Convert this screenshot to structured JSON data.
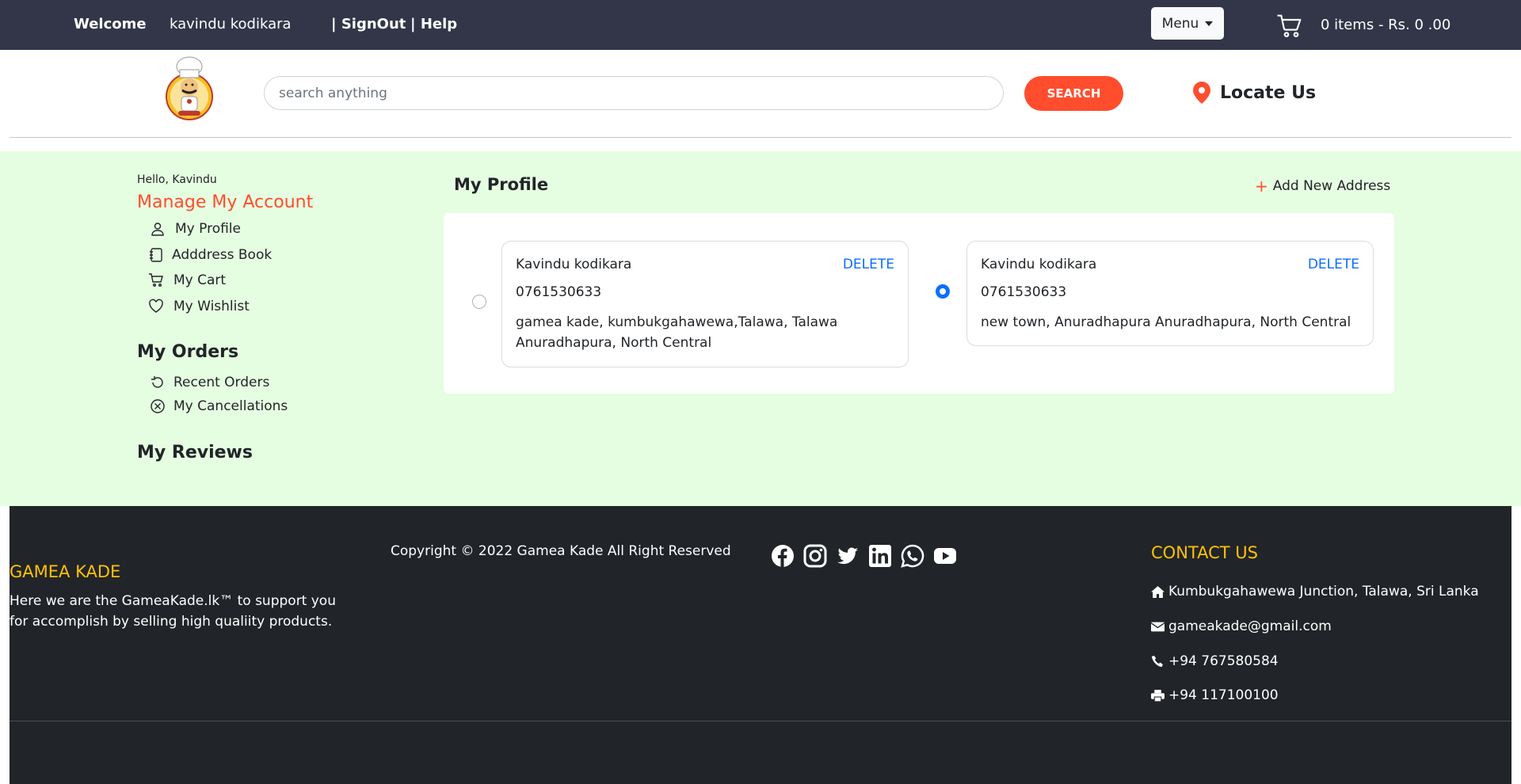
{
  "topbar": {
    "welcome": "Welcome",
    "username": "kavindu kodikara",
    "signout": "| SignOut",
    "help": "| Help",
    "menu_label": "Menu",
    "cart_summary": "0 items - Rs. 0 .00"
  },
  "header": {
    "search_placeholder": "search anything",
    "search_button": "SEARCH",
    "locate_us": "Locate Us"
  },
  "sidebar": {
    "hello": "Hello, Kavindu",
    "manage_title": "Manage My Account",
    "account_items": [
      {
        "label": "My  Profile",
        "icon": "user-icon"
      },
      {
        "label": "Adddress   Book",
        "icon": "address-book-icon"
      },
      {
        "label": "My  Cart",
        "icon": "cart-icon"
      },
      {
        "label": "My  Wishlist",
        "icon": "heart-icon"
      }
    ],
    "orders_title": "My Orders",
    "order_items": [
      {
        "label": "Recent Orders",
        "icon": "refresh-icon"
      },
      {
        "label": "My Cancellations",
        "icon": "cancel-circle-icon"
      }
    ],
    "reviews_title": "My Reviews"
  },
  "profile": {
    "title": "My Profile",
    "add_address": "Add New Address",
    "addresses": [
      {
        "name": "Kavindu kodikara",
        "delete": "DELETE",
        "phone": "0761530633",
        "address": "gamea kade, kumbukgahawewa,Talawa, Talawa Anuradhapura, North Central",
        "selected": false
      },
      {
        "name": "Kavindu kodikara",
        "delete": "DELETE",
        "phone": "0761530633",
        "address": "new town, Anuradhapura Anuradhapura, North Central",
        "selected": true
      }
    ]
  },
  "footer": {
    "brand": "GAMEA KADE",
    "about": "Here we are the GameaKade.lk™ to support you for accomplish by selling high qualiity products.",
    "copyright": "Copyright © 2022 Gamea Kade All Right Reserved",
    "social_icons": [
      "facebook-icon",
      "instagram-icon",
      "twitter-icon",
      "linkedin-icon",
      "whatsapp-icon",
      "youtube-icon"
    ],
    "contact_title": "CONTACT US",
    "address": "Kumbukgahawewa Junction, Talawa, Sri Lanka",
    "email": "gameakade@gmail.com",
    "phone": "+94 767580584",
    "fax": "+94 117100100"
  },
  "colors": {
    "topbar": "#323648",
    "accent": "#ff4d2e",
    "main_bg": "#e5fde0",
    "footer_bg": "#212529",
    "footer_heading": "#ffc107",
    "link_blue": "#0d6efd"
  }
}
